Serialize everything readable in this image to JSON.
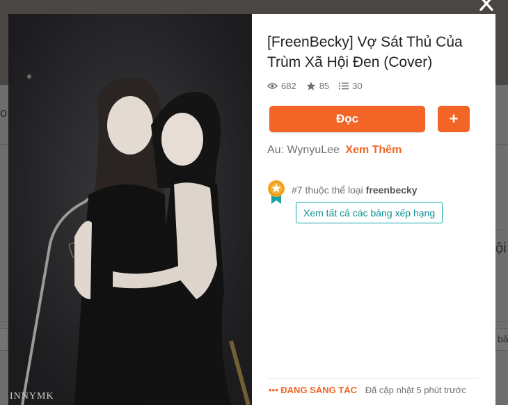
{
  "background": {
    "partial_texts": [
      "o",
      "ội",
      "bả"
    ]
  },
  "modal": {
    "close_icon": "×",
    "cover": {
      "watermark": "INNYMK"
    },
    "title": "[FreenBecky] Vợ Sát Thủ Của Trùm Xã Hội Đen (Cover)",
    "stats": {
      "reads": "682",
      "votes": "85",
      "parts": "30"
    },
    "read_label": "Đọc",
    "add_label": "+",
    "author_prefix": "Au:",
    "author_name": "WynyuLee",
    "see_more": "Xem Thêm",
    "ranking": {
      "rank": "#7",
      "middle": "thuộc thể loại",
      "category": "freenbecky",
      "button": "Xem tất cả các bảng xếp hạng"
    },
    "status": {
      "ongoing": "ĐANG SÁNG TÁC",
      "updated": "Đã cập nhật 5 phút trước"
    }
  },
  "colors": {
    "accent": "#f26527",
    "teal": "#0ea5a8",
    "overlay": "#6e6e6e"
  },
  "icons": [
    "eye-icon",
    "star-icon",
    "list-icon",
    "close-icon",
    "medal-icon",
    "ellipsis-icon"
  ]
}
